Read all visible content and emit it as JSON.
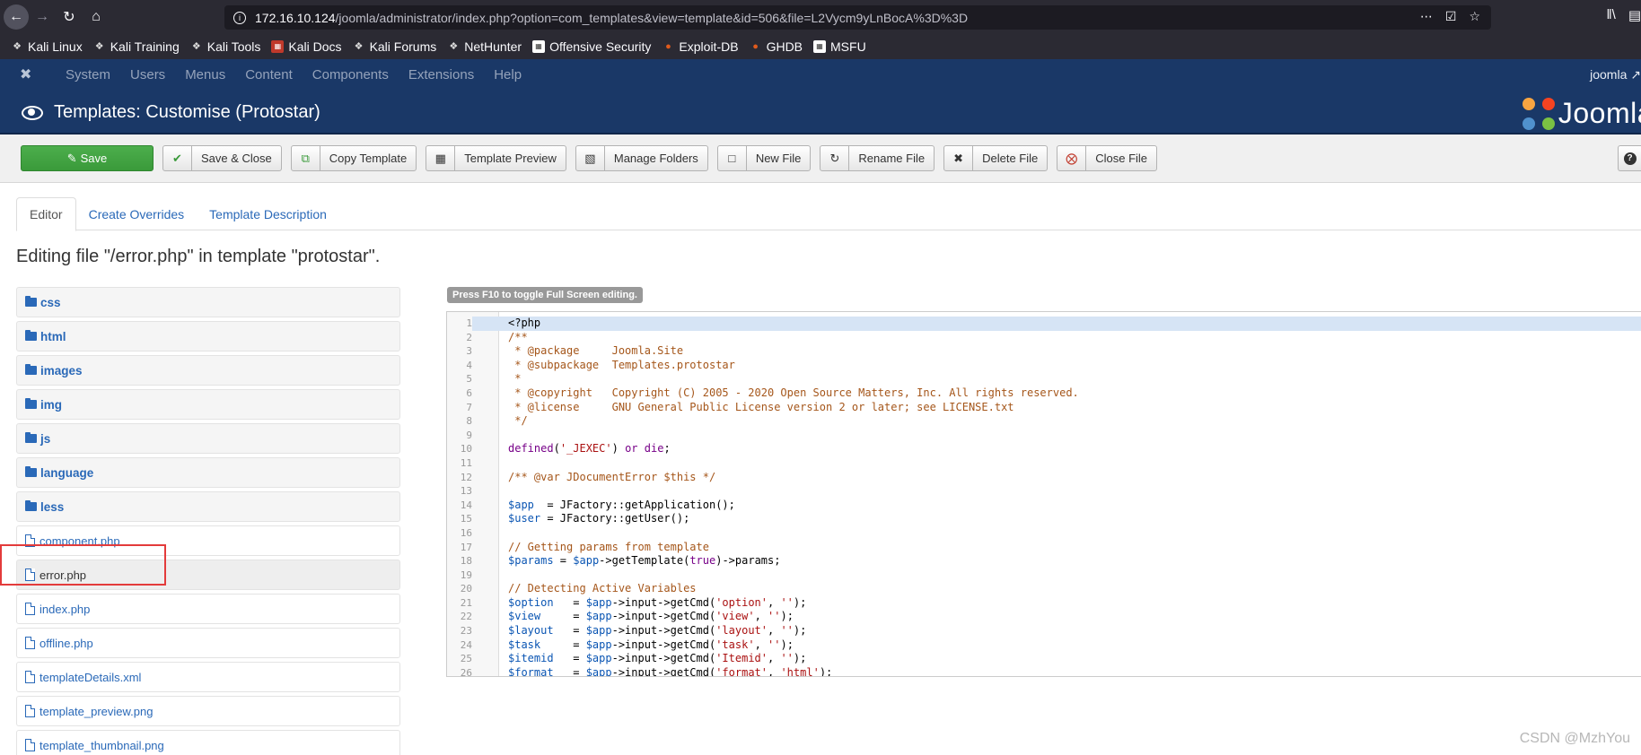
{
  "browser": {
    "url_host": "172.16.10.124",
    "url_path": "/joomla/administrator/index.php?option=com_templates&view=template&id=506&file=L2Vycm9yLnBocA%3D%3D",
    "bookmarks": [
      {
        "label": "Kali Linux",
        "icon": "dragon-icon"
      },
      {
        "label": "Kali Training",
        "icon": "dragon-icon"
      },
      {
        "label": "Kali Tools",
        "icon": "dragon-icon"
      },
      {
        "label": "Kali Docs",
        "icon": "pdf-icon"
      },
      {
        "label": "Kali Forums",
        "icon": "dragon-icon"
      },
      {
        "label": "NetHunter",
        "icon": "dragon-icon"
      },
      {
        "label": "Offensive Security",
        "icon": "offsec-icon"
      },
      {
        "label": "Exploit-DB",
        "icon": "bug-icon"
      },
      {
        "label": "GHDB",
        "icon": "bug-icon"
      },
      {
        "label": "MSFU",
        "icon": "offsec-icon"
      }
    ]
  },
  "admin_nav": {
    "menu": [
      "System",
      "Users",
      "Menus",
      "Content",
      "Components",
      "Extensions",
      "Help"
    ],
    "user": "joomla"
  },
  "header": {
    "title": "Templates: Customise (Protostar)",
    "brand": "Joomla"
  },
  "toolbar": {
    "buttons": [
      {
        "label": "Save",
        "icon": "edit-icon"
      },
      {
        "label": "Save & Close",
        "icon": "check-icon"
      },
      {
        "label": "Copy Template",
        "icon": "copy-icon"
      },
      {
        "label": "Template Preview",
        "icon": "image-icon"
      },
      {
        "label": "Manage Folders",
        "icon": "folder-icon"
      },
      {
        "label": "New File",
        "icon": "file-icon"
      },
      {
        "label": "Rename File",
        "icon": "refresh-icon"
      },
      {
        "label": "Delete File",
        "icon": "close-icon"
      },
      {
        "label": "Close File",
        "icon": "cancel-circle-icon"
      }
    ],
    "help": "?"
  },
  "tabs": [
    "Editor",
    "Create Overrides",
    "Template Description"
  ],
  "editing_title": "Editing file \"/error.php\" in template \"protostar\".",
  "file_tree": {
    "folders": [
      "css",
      "html",
      "images",
      "img",
      "js",
      "language",
      "less"
    ],
    "files": [
      "component.php",
      "error.php",
      "index.php",
      "offline.php",
      "templateDetails.xml",
      "template_preview.png",
      "template_thumbnail.png"
    ],
    "current_file": "error.php"
  },
  "editor": {
    "hint": "Press F10 to toggle Full Screen editing.",
    "lines": [
      {
        "n": "1",
        "t": "<?php",
        "s": "plain"
      },
      {
        "n": "2",
        "t": "/**",
        "s": "comment"
      },
      {
        "n": "3",
        "t": " * @package     Joomla.Site",
        "s": "comment"
      },
      {
        "n": "4",
        "t": " * @subpackage  Templates.protostar",
        "s": "comment"
      },
      {
        "n": "5",
        "t": " *",
        "s": "comment"
      },
      {
        "n": "6",
        "t": " * @copyright   Copyright (C) 2005 - 2020 Open Source Matters, Inc. All rights reserved.",
        "s": "comment"
      },
      {
        "n": "7",
        "t": " * @license     GNU General Public License version 2 or later; see LICENSE.txt",
        "s": "comment"
      },
      {
        "n": "8",
        "t": " */",
        "s": "comment"
      },
      {
        "n": "9",
        "t": "",
        "s": "plain"
      },
      {
        "n": "10",
        "t": "defined('_JEXEC') or die;",
        "s": "mixed"
      },
      {
        "n": "11",
        "t": "",
        "s": "plain"
      },
      {
        "n": "12",
        "t": "/** @var JDocumentError $this */",
        "s": "comment"
      },
      {
        "n": "13",
        "t": "",
        "s": "plain"
      },
      {
        "n": "14",
        "t": "$app  = JFactory::getApplication();",
        "s": "mixed"
      },
      {
        "n": "15",
        "t": "$user = JFactory::getUser();",
        "s": "mixed"
      },
      {
        "n": "16",
        "t": "",
        "s": "plain"
      },
      {
        "n": "17",
        "t": "// Getting params from template",
        "s": "comment"
      },
      {
        "n": "18",
        "t": "$params = $app->getTemplate(true)->params;",
        "s": "mixed"
      },
      {
        "n": "19",
        "t": "",
        "s": "plain"
      },
      {
        "n": "20",
        "t": "// Detecting Active Variables",
        "s": "comment"
      },
      {
        "n": "21",
        "t": "$option   = $app->input->getCmd('option', '');",
        "s": "mixed"
      },
      {
        "n": "22",
        "t": "$view     = $app->input->getCmd('view', '');",
        "s": "mixed"
      },
      {
        "n": "23",
        "t": "$layout   = $app->input->getCmd('layout', '');",
        "s": "mixed"
      },
      {
        "n": "24",
        "t": "$task     = $app->input->getCmd('task', '');",
        "s": "mixed"
      },
      {
        "n": "25",
        "t": "$itemid   = $app->input->getCmd('Itemid', '');",
        "s": "mixed"
      },
      {
        "n": "26",
        "t": "$format   = $app->input->getCmd('format', 'html');",
        "s": "mixed"
      }
    ]
  },
  "watermark": "CSDN @MzhYou",
  "colors": {
    "navbar": "#1a3867",
    "link": "#2a69b8",
    "save_green": "#3a9a3a",
    "highlight_red": "#e33b3b"
  }
}
